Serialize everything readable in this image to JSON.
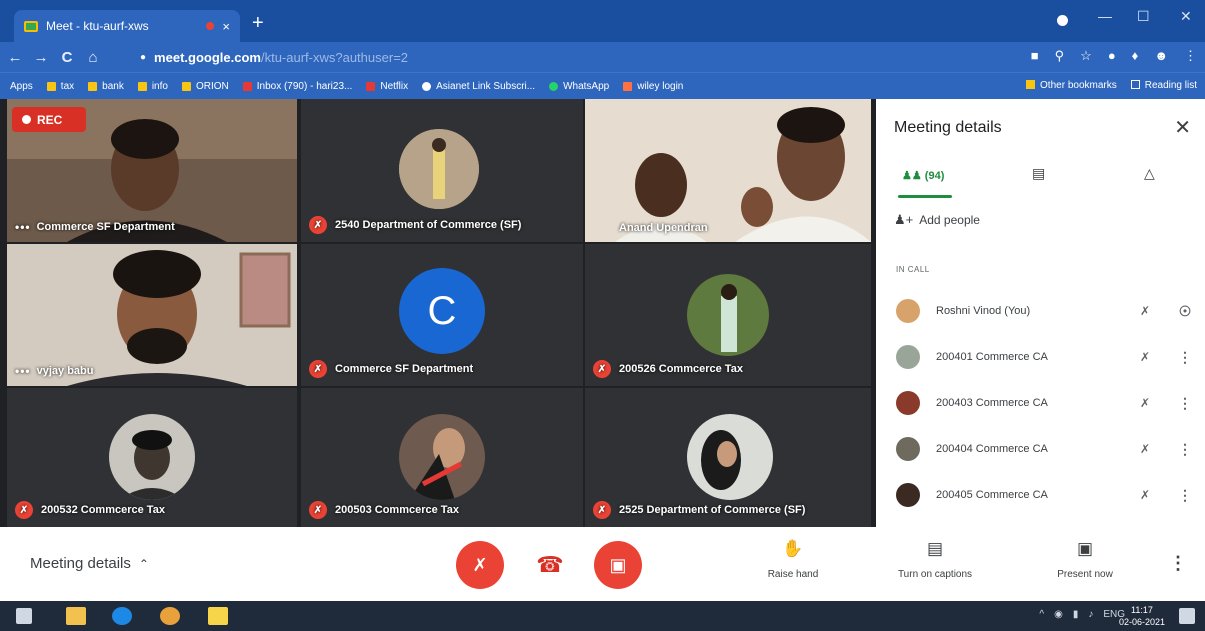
{
  "browser": {
    "tab_title": "Meet - ktu-aurf-xws",
    "tab_close": "×",
    "new_tab": "+",
    "window_controls": [
      "—",
      "☐",
      "✕"
    ],
    "url_host": "meet.google.com",
    "url_path": "/ktu-aurf-xws?authuser=2",
    "nav": {
      "back": "←",
      "forward": "→",
      "reload": "C",
      "home": "⌂"
    },
    "bookmarks": [
      {
        "label": "Apps",
        "icon": "apps-grid-icon"
      },
      {
        "label": "tax",
        "icon": "folder-icon"
      },
      {
        "label": "bank",
        "icon": "folder-icon"
      },
      {
        "label": "info",
        "icon": "folder-icon"
      },
      {
        "label": "ORION",
        "icon": "folder-icon"
      },
      {
        "label": "Inbox (790) - hari23...",
        "icon": "gmail-icon"
      },
      {
        "label": "Netflix",
        "icon": "netflix-icon"
      },
      {
        "label": "Asianet Link Subscri...",
        "icon": "globe-icon"
      },
      {
        "label": "WhatsApp",
        "icon": "whatsapp-icon"
      },
      {
        "label": "wiley login",
        "icon": "bookmark-icon"
      }
    ],
    "bookmarks_right": [
      "Other bookmarks",
      "Reading list"
    ]
  },
  "meeting": {
    "rec_label": "REC",
    "tiles": [
      {
        "name": "Commerce SF Department",
        "state": "dots"
      },
      {
        "name": "2540 Department of Commerce (SF)",
        "state": "muted"
      },
      {
        "name": "Anand Upendran",
        "state": "none"
      },
      {
        "name": "vyjay babu",
        "state": "dots"
      },
      {
        "name": "Commerce SF Department",
        "state": "muted",
        "letter": "C"
      },
      {
        "name": "200526 Commcerce Tax",
        "state": "muted"
      },
      {
        "name": "200532 Commcerce Tax",
        "state": "muted"
      },
      {
        "name": "200503 Commcerce Tax",
        "state": "muted"
      },
      {
        "name": "2525 Department of Commerce (SF)",
        "state": "muted"
      }
    ]
  },
  "panel": {
    "title": "Meeting details",
    "close": "✕",
    "people_count": "(94)",
    "add_people": "Add people",
    "section": "IN CALL",
    "participants": [
      {
        "name": "Roshni Vinod (You)",
        "action_icon": "pin-icon"
      },
      {
        "name": "200401 Commerce CA",
        "action_icon": "more-vert-icon"
      },
      {
        "name": "200403 Commerce CA",
        "action_icon": "more-vert-icon"
      },
      {
        "name": "200404 Commerce CA",
        "action_icon": "more-vert-icon"
      },
      {
        "name": "200405 Commerce CA",
        "action_icon": "more-vert-icon"
      }
    ]
  },
  "controls": {
    "meeting_details": "Meeting details",
    "raise_hand": "Raise hand",
    "captions": "Turn on captions",
    "present": "Present now"
  },
  "taskbar": {
    "lang": "ENG",
    "time": "11:17",
    "date": "02-06-2021"
  },
  "colors": {
    "chrome_blue": "#1a4fa0",
    "meet_red": "#ea4335",
    "accent_green": "#1e8e3e",
    "avatar_blue": "#1967d2"
  }
}
